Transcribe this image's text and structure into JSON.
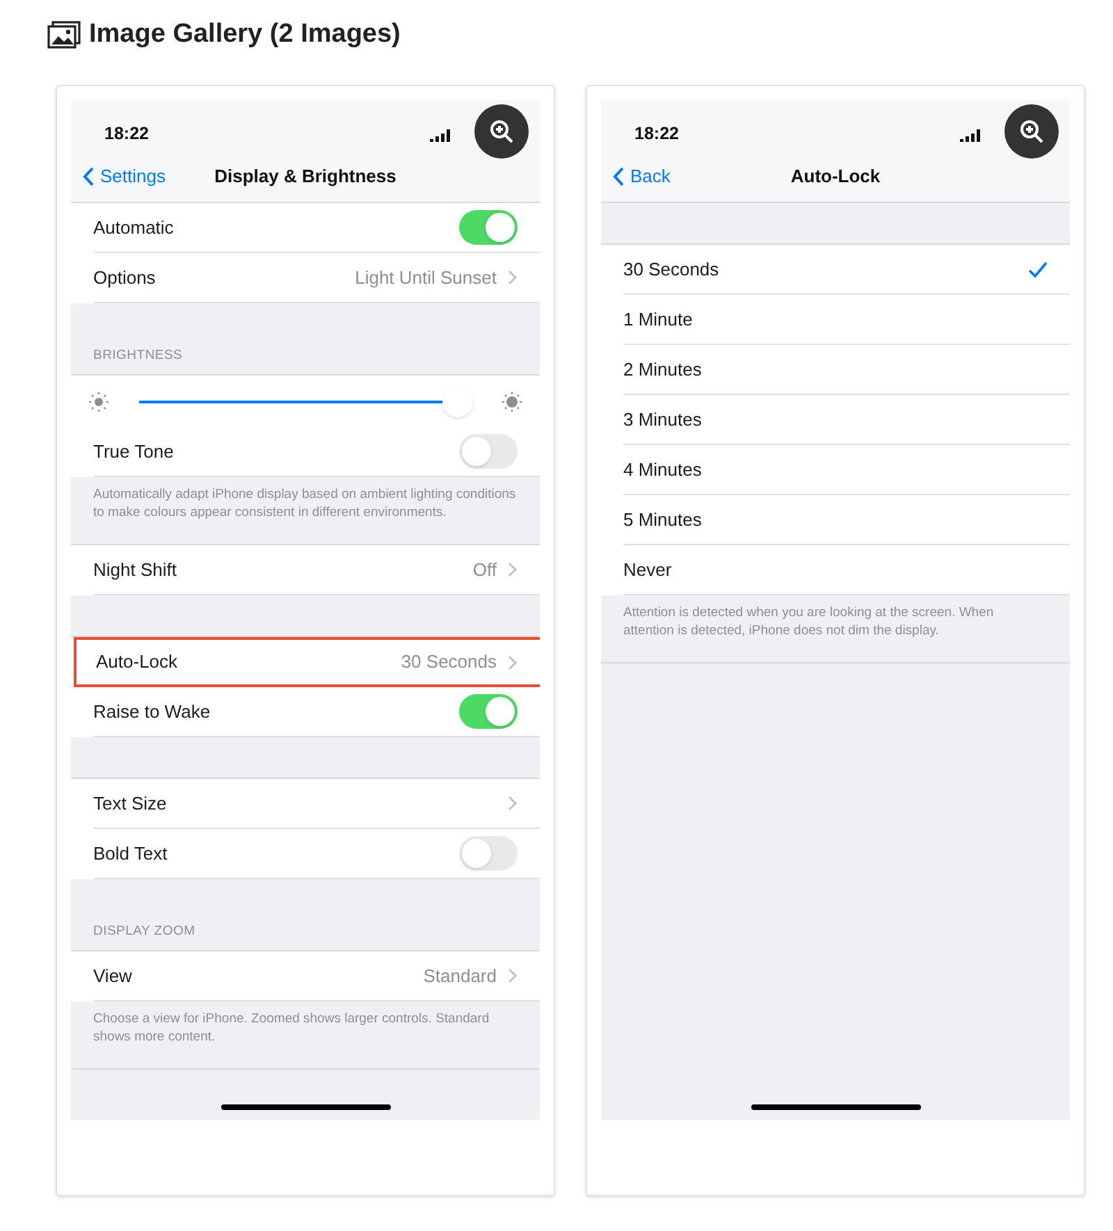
{
  "gallery": {
    "title": "Image Gallery (2 Images)"
  },
  "images": [
    {
      "time": "18:22",
      "back": "Settings",
      "title": "Display & Brightness",
      "rows": [
        {
          "kind": "toggle",
          "label": "Automatic",
          "on": true
        },
        {
          "kind": "link",
          "label": "Options",
          "value": "Light Until Sunset"
        },
        {
          "kind": "header",
          "label": "BRIGHTNESS"
        },
        {
          "kind": "slider",
          "level": 0.96
        },
        {
          "kind": "toggle",
          "label": "True Tone",
          "on": false
        },
        {
          "kind": "footer",
          "label": "Automatically adapt iPhone display based on ambient lighting conditions to make colours appear consistent in different environments."
        },
        {
          "kind": "link",
          "label": "Night Shift",
          "value": "Off"
        },
        {
          "kind": "gap"
        },
        {
          "kind": "link",
          "label": "Auto-Lock",
          "value": "30 Seconds",
          "highlighted": true
        },
        {
          "kind": "toggle",
          "label": "Raise to Wake",
          "on": true
        },
        {
          "kind": "gap"
        },
        {
          "kind": "link",
          "label": "Text Size"
        },
        {
          "kind": "toggle",
          "label": "Bold Text",
          "on": false
        },
        {
          "kind": "header",
          "label": "DISPLAY ZOOM"
        },
        {
          "kind": "link",
          "label": "View",
          "value": "Standard"
        },
        {
          "kind": "footer",
          "label": "Choose a view for iPhone. Zoomed shows larger controls. Standard shows more content."
        }
      ]
    },
    {
      "time": "18:22",
      "back": "Back",
      "title": "Auto-Lock",
      "rows": [
        {
          "kind": "gap"
        },
        {
          "kind": "option",
          "label": "30 Seconds",
          "selected": true
        },
        {
          "kind": "option",
          "label": "1 Minute",
          "selected": false
        },
        {
          "kind": "option",
          "label": "2 Minutes",
          "selected": false
        },
        {
          "kind": "option",
          "label": "3 Minutes",
          "selected": false
        },
        {
          "kind": "option",
          "label": "4 Minutes",
          "selected": false
        },
        {
          "kind": "option",
          "label": "5 Minutes",
          "selected": false
        },
        {
          "kind": "option",
          "label": "Never",
          "selected": false
        },
        {
          "kind": "footer",
          "label": "Attention is detected when you are looking at the screen. When attention is detected, iPhone does not dim the display."
        }
      ]
    }
  ]
}
